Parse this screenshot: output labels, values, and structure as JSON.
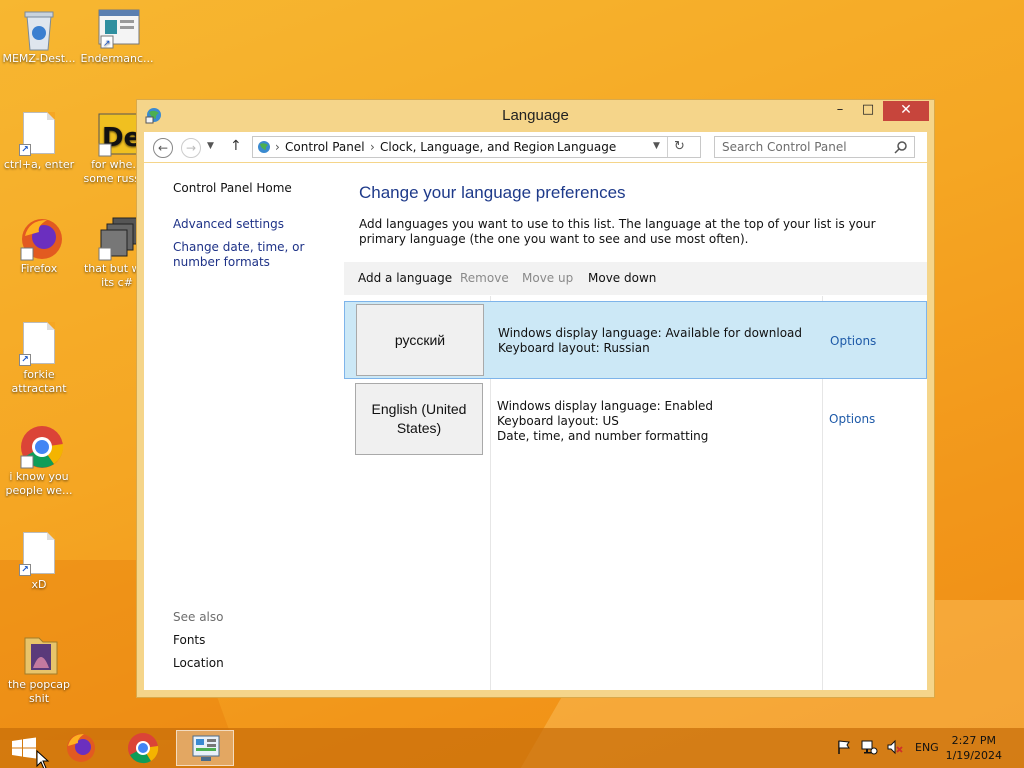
{
  "desktop": {
    "icons": [
      {
        "label": "MEMZ-Dest...",
        "kind": "recycle-bin"
      },
      {
        "label": "Endermanc...",
        "kind": "window-app"
      },
      {
        "label": "ctrl+a, enter",
        "kind": "file"
      },
      {
        "label": "for whe... some russ...",
        "kind": "de-app"
      },
      {
        "label": "Firefox",
        "kind": "firefox"
      },
      {
        "label": "that but w... its c#",
        "kind": "stack"
      },
      {
        "label": "forkie attractant",
        "kind": "file"
      },
      {
        "label": "i know you people we...",
        "kind": "chrome"
      },
      {
        "label": "xD",
        "kind": "file"
      },
      {
        "label": "the popcap shit",
        "kind": "folder"
      }
    ]
  },
  "window": {
    "title": "Language",
    "minimize": "–",
    "maximize": "□",
    "close": "✕"
  },
  "address": {
    "breadcrumbs": [
      "Control Panel",
      "Clock, Language, and Region",
      "Language"
    ],
    "separator": "›",
    "search_placeholder": "Search Control Panel"
  },
  "left_pane": {
    "home": "Control Panel Home",
    "links": [
      "Advanced settings",
      "Change date, time, or number formats"
    ],
    "see_also_title": "See also",
    "see_also": [
      "Fonts",
      "Location"
    ]
  },
  "main": {
    "heading": "Change your language preferences",
    "description": "Add languages you want to use to this list. The language at the top of your list is your primary language (the one you want to see and use most often).",
    "toolbar": {
      "add": "Add a language",
      "remove": "Remove",
      "move_up": "Move up",
      "move_down": "Move down"
    },
    "languages": [
      {
        "name": "русский",
        "lines": [
          "Windows display language: Available for download",
          "Keyboard layout: Russian"
        ],
        "options": "Options",
        "selected": true
      },
      {
        "name": "English (United States)",
        "lines": [
          "Windows display language: Enabled",
          "Keyboard layout: US",
          "Date, time, and number formatting"
        ],
        "options": "Options",
        "selected": false
      }
    ]
  },
  "taskbar": {
    "apps": [
      "firefox",
      "chrome",
      "control-panel"
    ],
    "lang": "ENG",
    "time": "2:27 PM",
    "date": "1/19/2024"
  },
  "colors": {
    "accent": "#1e3a8a",
    "selection": "#cce8f6",
    "close_button": "#c7453c",
    "desktop": "#f5a623"
  }
}
